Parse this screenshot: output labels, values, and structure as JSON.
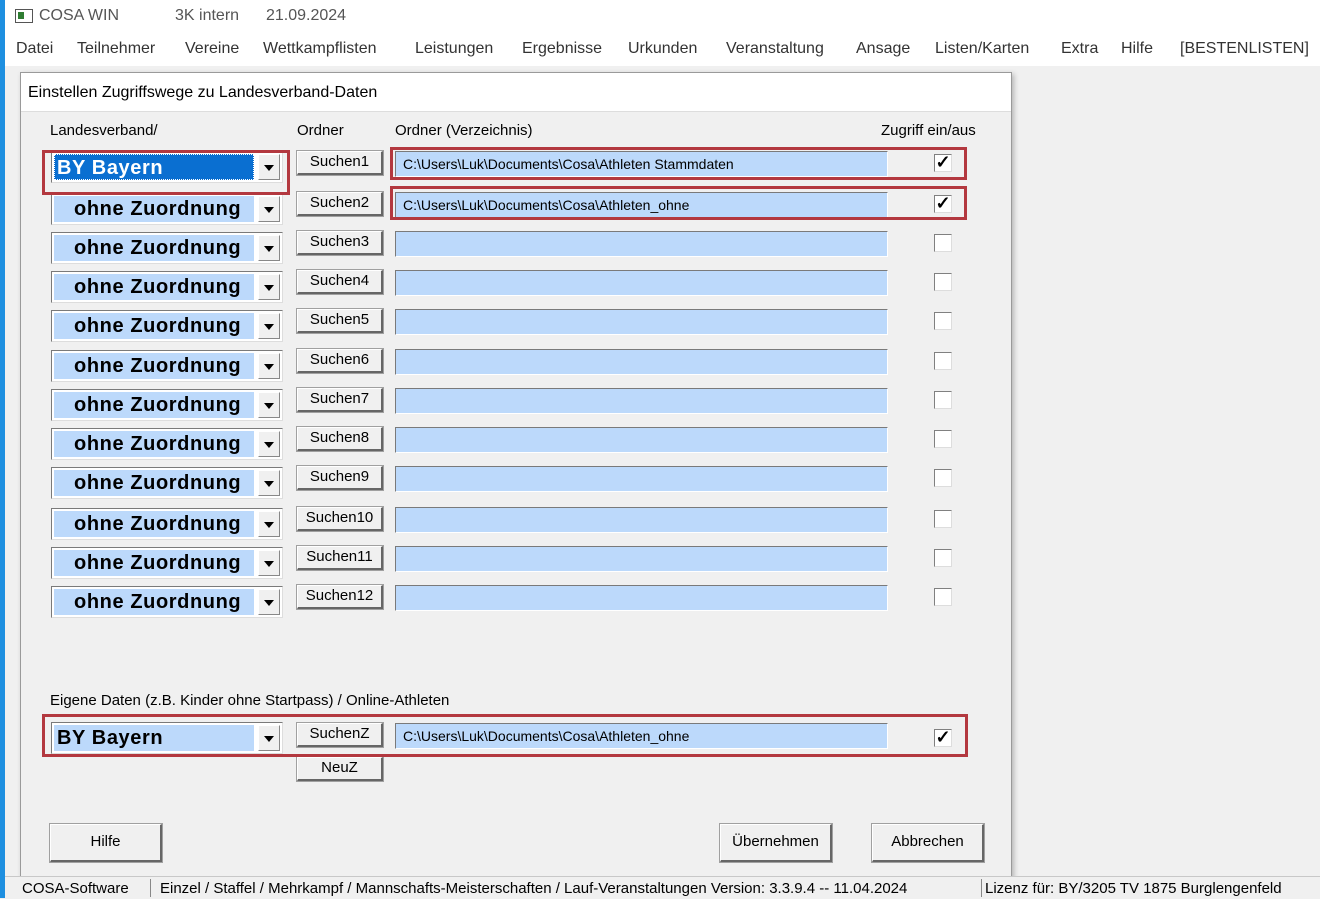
{
  "titlebar": {
    "app_name": "COSA WIN",
    "mode": "3K intern",
    "date": "21.09.2024"
  },
  "menubar": {
    "items": [
      "Datei",
      "Teilnehmer",
      "Vereine",
      "Wettkampflisten",
      "Leistungen",
      "Ergebnisse",
      "Urkunden",
      "Veranstaltung",
      "Ansage",
      "Listen/Karten",
      "Extra",
      "Hilfe",
      "[BESTENLISTEN]"
    ]
  },
  "dialog": {
    "title": "Einstellen Zugriffswege zu Landesverband-Daten",
    "headers": {
      "landesverband": "Landesverband/",
      "ordner": "Ordner",
      "verzeichnis": "Ordner (Verzeichnis)",
      "zugriff": "Zugriff ein/aus"
    },
    "rows": [
      {
        "verband": "BY Bayern",
        "button": "Suchen1",
        "path": "C:\\Users\\Luk\\Documents\\Cosa\\Athleten Stammdaten",
        "checked": true,
        "selected": true
      },
      {
        "verband": "ohne Zuordnung",
        "button": "Suchen2",
        "path": "C:\\Users\\Luk\\Documents\\Cosa\\Athleten_ohne",
        "checked": true
      },
      {
        "verband": "ohne Zuordnung",
        "button": "Suchen3",
        "path": "",
        "checked": false
      },
      {
        "verband": "ohne Zuordnung",
        "button": "Suchen4",
        "path": "",
        "checked": false
      },
      {
        "verband": "ohne Zuordnung",
        "button": "Suchen5",
        "path": "",
        "checked": false
      },
      {
        "verband": "ohne Zuordnung",
        "button": "Suchen6",
        "path": "",
        "checked": false
      },
      {
        "verband": "ohne Zuordnung",
        "button": "Suchen7",
        "path": "",
        "checked": false
      },
      {
        "verband": "ohne Zuordnung",
        "button": "Suchen8",
        "path": "",
        "checked": false
      },
      {
        "verband": "ohne Zuordnung",
        "button": "Suchen9",
        "path": "",
        "checked": false
      },
      {
        "verband": "ohne Zuordnung",
        "button": "Suchen10",
        "path": "",
        "checked": false
      },
      {
        "verband": "ohne Zuordnung",
        "button": "Suchen11",
        "path": "",
        "checked": false
      },
      {
        "verband": "ohne Zuordnung",
        "button": "Suchen12",
        "path": "",
        "checked": false
      }
    ],
    "own_data": {
      "label": "Eigene Daten (z.B. Kinder ohne Startpass) / Online-Athleten",
      "verband": "BY Bayern",
      "button": "SuchenZ",
      "path": "C:\\Users\\Luk\\Documents\\Cosa\\Athleten_ohne",
      "checked": true,
      "new_button": "NeuZ"
    },
    "buttons": {
      "help": "Hilfe",
      "apply": "Übernehmen",
      "cancel": "Abbrechen"
    },
    "highlight_color": "#b3383f"
  },
  "statusbar": {
    "company": "COSA-Software",
    "info": "Einzel / Staffel / Mehrkampf / Mannschafts-Meisterschaften / Lauf-Veranstaltungen  Version:  3.3.9.4 -- 11.04.2024",
    "license": "Lizenz für: BY/3205  TV 1875 Burglengenfeld"
  }
}
